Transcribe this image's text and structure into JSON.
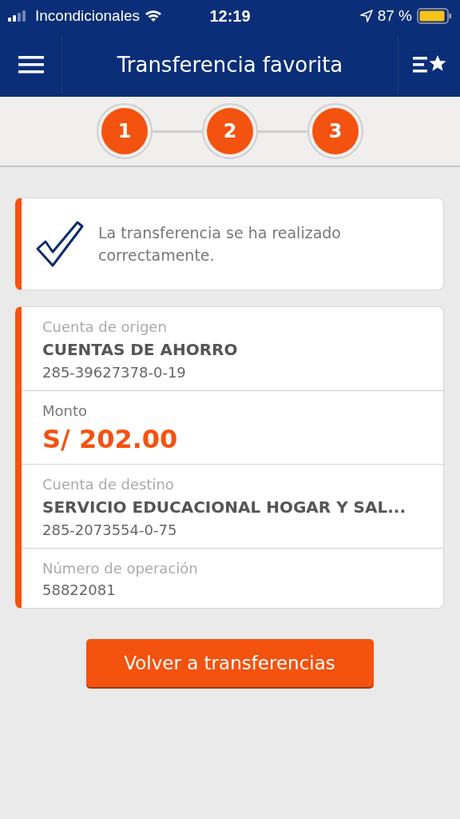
{
  "status_bar": {
    "carrier": "Incondicionales",
    "time": "12:19",
    "battery": "87 %"
  },
  "header": {
    "title": "Transferencia favorita"
  },
  "steps": [
    {
      "label": "1",
      "done": true
    },
    {
      "label": "2",
      "done": true
    },
    {
      "label": "3",
      "done": true
    }
  ],
  "confirmation": {
    "message": "La transferencia se ha realizado correctamente."
  },
  "details": [
    {
      "kind": "account",
      "label": "Cuenta de origen",
      "name": "CUENTAS DE AHORRO",
      "number": "285-39627378-0-19"
    },
    {
      "kind": "amount",
      "label": "Monto",
      "value": "S/ 202.00"
    },
    {
      "kind": "account",
      "label": "Cuenta de destino",
      "name": "SERVICIO EDUCACIONAL HOGAR Y SAL...",
      "number": "285-2073554-0-75"
    },
    {
      "kind": "operation",
      "label": "Número de operación",
      "number": "58822081"
    }
  ],
  "button": "Volver a transferencias"
}
